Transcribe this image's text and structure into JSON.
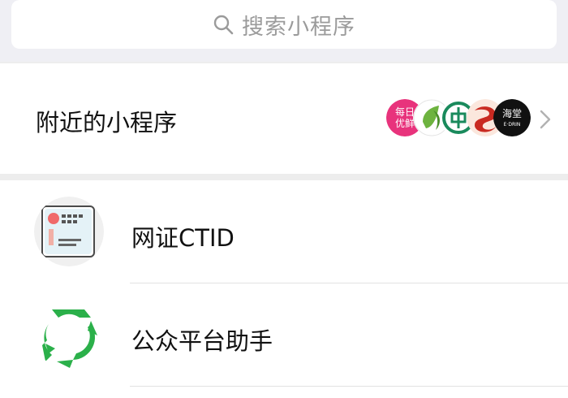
{
  "search": {
    "placeholder": "搜索小程序"
  },
  "nearby": {
    "label": "附近的小程序",
    "avatars": [
      {
        "icon": "daily-fresh-logo",
        "line1": "每日",
        "line2": "优鲜",
        "color": "#e8337c"
      },
      {
        "icon": "green-leaf-logo",
        "color": "#6db33f"
      },
      {
        "icon": "bank-coin-logo",
        "color": "#1a8a5c"
      },
      {
        "icon": "red-swirl-logo",
        "color": "#c92a21"
      },
      {
        "icon": "black-shop-logo",
        "line1": "海堂",
        "line2": "E·DRIN",
        "color": "#111111"
      }
    ]
  },
  "items": [
    {
      "label": "网证CTID",
      "icon": "id-card-icon"
    },
    {
      "label": "公众平台助手",
      "icon": "recycle-arrows-icon",
      "color": "#2bb04a"
    }
  ]
}
